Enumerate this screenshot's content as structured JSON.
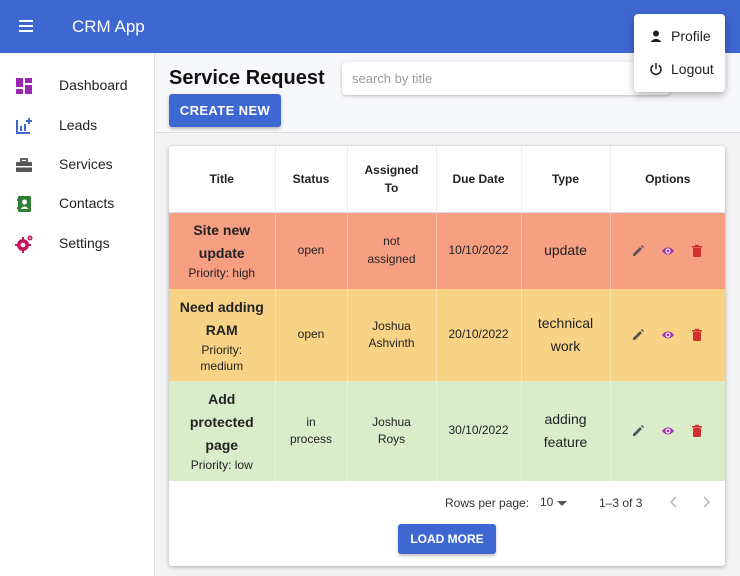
{
  "app": {
    "title": "CRM App"
  },
  "sidebar": {
    "items": [
      {
        "label": "Dashboard",
        "icon": "dashboard-icon",
        "color": "#9c27b0"
      },
      {
        "label": "Leads",
        "icon": "leads-chart-icon",
        "color": "#3f67d1"
      },
      {
        "label": "Services",
        "icon": "briefcase-icon",
        "color": "#555555"
      },
      {
        "label": "Contacts",
        "icon": "contacts-icon",
        "color": "#2e7d32"
      },
      {
        "label": "Settings",
        "icon": "settings-icon",
        "color": "#c2185b"
      }
    ]
  },
  "main": {
    "page_title": "Service Request",
    "search_placeholder": "search by title",
    "create_label": "CREATE NEW"
  },
  "table": {
    "headers": [
      "Title",
      "Status",
      "Assigned To",
      "Due Date",
      "Type",
      "Options"
    ],
    "rows": [
      {
        "title": "Site new update",
        "priority": "Priority: high",
        "status": "open",
        "assigned": "not assigned",
        "due": "10/10/2022",
        "type": "update",
        "bg": "#f69f83"
      },
      {
        "title": "Need adding RAM",
        "priority": "Priority: medium",
        "status": "open",
        "assigned": "Joshua Ashvinth",
        "due": "20/10/2022",
        "type": "technical work",
        "bg": "#f8d285"
      },
      {
        "title": "Add protected page",
        "priority": "Priority: low",
        "status": "in process",
        "assigned": "Joshua Roys",
        "due": "30/10/2022",
        "type": "adding feature",
        "bg": "#d9edcb"
      }
    ],
    "option_icons": [
      "edit-icon",
      "view-icon",
      "delete-icon"
    ],
    "option_colors": {
      "edit": "#555555",
      "view": "#9c27b0",
      "delete": "#d32f2f"
    }
  },
  "pagination": {
    "rows_per_page_label": "Rows per page:",
    "rows_per_page_value": "10",
    "range": "1–3 of 3"
  },
  "load_more_label": "LOAD MORE",
  "user_menu": {
    "items": [
      {
        "label": "Profile",
        "icon": "person-icon"
      },
      {
        "label": "Logout",
        "icon": "power-icon"
      }
    ]
  },
  "colors": {
    "primary": "#3f67d1"
  }
}
